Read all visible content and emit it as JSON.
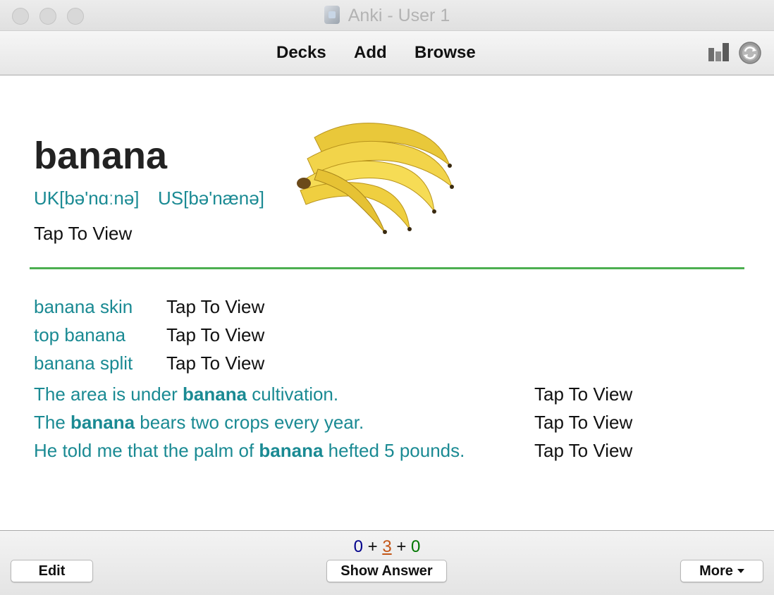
{
  "window": {
    "title": "Anki - User 1"
  },
  "toolbar": {
    "decks": "Decks",
    "add": "Add",
    "browse": "Browse"
  },
  "card": {
    "word": "banana",
    "pron_uk": "UK[bə'nɑːnə]",
    "pron_us": "US[bə'nænə]",
    "meaning_tap": "Tap To View",
    "phrases": [
      {
        "text": "banana skin",
        "tap": "Tap To View"
      },
      {
        "text": "top banana",
        "tap": "Tap To View"
      },
      {
        "text": "banana split",
        "tap": "Tap To View"
      }
    ],
    "sentences": [
      {
        "before": "The area is under ",
        "bold": "banana",
        "after": " cultivation.",
        "tap": "Tap To View"
      },
      {
        "before": "The ",
        "bold": "banana",
        "after": " bears two crops every year.",
        "tap": "Tap To View"
      },
      {
        "before": "He told me that the palm of ",
        "bold": "banana",
        "after": " hefted 5 pounds.",
        "tap": "Tap To View"
      }
    ],
    "accent_color": "#1a8a93",
    "divider_color": "#4caf50"
  },
  "bottom": {
    "count_new": "0",
    "count_learning": "3",
    "count_review": "0",
    "plus": "+",
    "colors": {
      "new": "#00008b",
      "learning": "#c35617",
      "review": "#007700"
    },
    "edit": "Edit",
    "show_answer": "Show Answer",
    "more": "More"
  }
}
